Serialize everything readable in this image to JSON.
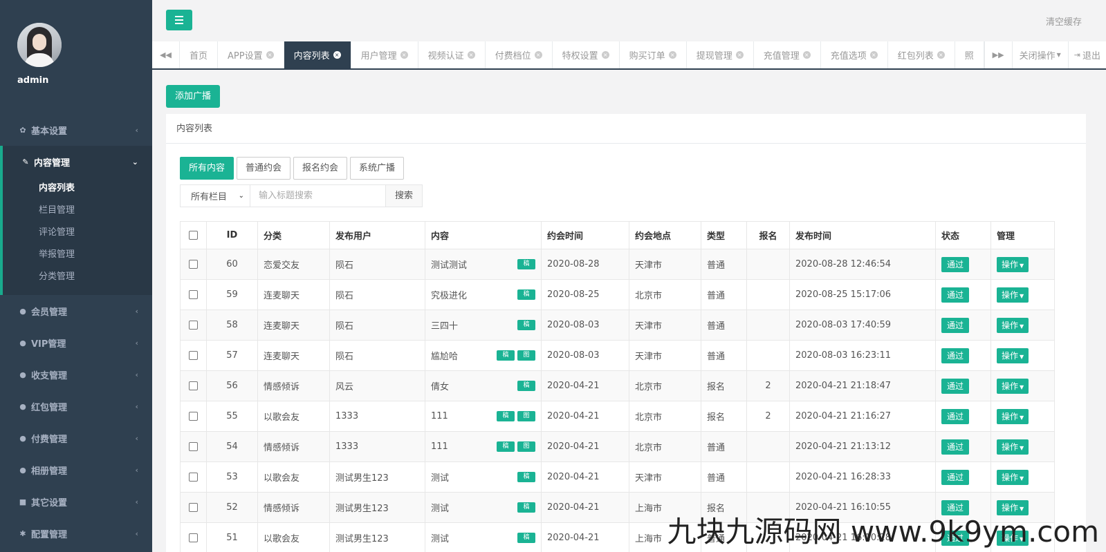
{
  "sidebar": {
    "username": "admin",
    "menu": [
      {
        "label": "基本设置",
        "icon": "gear-icon",
        "glyph": "✿"
      },
      {
        "label": "内容管理",
        "icon": "edit-icon",
        "glyph": "✎",
        "expanded": true,
        "children": [
          "内容列表",
          "栏目管理",
          "评论管理",
          "举报管理",
          "分类管理"
        ]
      },
      {
        "label": "会员管理",
        "icon": "user-icon",
        "glyph": "●"
      },
      {
        "label": "VIP管理",
        "icon": "user-icon",
        "glyph": "●"
      },
      {
        "label": "收支管理",
        "icon": "user-icon",
        "glyph": "●"
      },
      {
        "label": "红包管理",
        "icon": "user-icon",
        "glyph": "●"
      },
      {
        "label": "付费管理",
        "icon": "user-icon",
        "glyph": "●"
      },
      {
        "label": "相册管理",
        "icon": "user-icon",
        "glyph": "●"
      },
      {
        "label": "其它设置",
        "icon": "list-icon",
        "glyph": "■"
      },
      {
        "label": "配置管理",
        "icon": "asterisk-icon",
        "glyph": "✱"
      }
    ]
  },
  "topbar": {
    "clear_cache": "清空缓存"
  },
  "tabs": {
    "items": [
      {
        "label": "首页",
        "closable": false
      },
      {
        "label": "APP设置",
        "closable": true
      },
      {
        "label": "内容列表",
        "closable": true,
        "active": true
      },
      {
        "label": "用户管理",
        "closable": true
      },
      {
        "label": "视频认证",
        "closable": true
      },
      {
        "label": "付费档位",
        "closable": true
      },
      {
        "label": "特权设置",
        "closable": true
      },
      {
        "label": "购买订单",
        "closable": true
      },
      {
        "label": "提现管理",
        "closable": true
      },
      {
        "label": "充值管理",
        "closable": true
      },
      {
        "label": "充值选项",
        "closable": true
      },
      {
        "label": "红包列表",
        "closable": true
      },
      {
        "label": "照",
        "closable": false
      }
    ],
    "close_ops": "关闭操作",
    "logout": "退出"
  },
  "main": {
    "add_button": "添加广播",
    "panel_title": "内容列表",
    "filters": [
      "所有内容",
      "普通约会",
      "报名约会",
      "系统广播"
    ],
    "category_select": "所有栏目",
    "search_placeholder": "输入标题搜索",
    "search_button": "搜索",
    "table": {
      "columns": [
        "ID",
        "分类",
        "发布用户",
        "内容",
        "约会时间",
        "约会地点",
        "类型",
        "报名",
        "发布时间",
        "状态",
        "管理"
      ],
      "tag_labels": {
        "draft": "稿",
        "image": "图"
      },
      "status_label": "通过",
      "op_label": "操作",
      "rows": [
        {
          "id": "60",
          "category": "恋爱交友",
          "user": "陨石",
          "content": "测试测试",
          "tags": [
            "稿"
          ],
          "date": "2020-08-28",
          "place": "天津市",
          "type": "普通",
          "signup": "",
          "published": "2020-08-28 12:46:54"
        },
        {
          "id": "59",
          "category": "连麦聊天",
          "user": "陨石",
          "content": "究极进化",
          "tags": [
            "稿"
          ],
          "date": "2020-08-25",
          "place": "北京市",
          "type": "普通",
          "signup": "",
          "published": "2020-08-25 15:17:06"
        },
        {
          "id": "58",
          "category": "连麦聊天",
          "user": "陨石",
          "content": "三四十",
          "tags": [
            "稿"
          ],
          "date": "2020-08-03",
          "place": "天津市",
          "type": "普通",
          "signup": "",
          "published": "2020-08-03 17:40:59"
        },
        {
          "id": "57",
          "category": "连麦聊天",
          "user": "陨石",
          "content": "尴尬哈",
          "tags": [
            "稿",
            "图"
          ],
          "date": "2020-08-03",
          "place": "天津市",
          "type": "普通",
          "signup": "",
          "published": "2020-08-03 16:23:11"
        },
        {
          "id": "56",
          "category": "情感倾诉",
          "user": "风云",
          "content": "倩女",
          "tags": [
            "稿"
          ],
          "date": "2020-04-21",
          "place": "北京市",
          "type": "报名",
          "signup": "2",
          "published": "2020-04-21 21:18:47"
        },
        {
          "id": "55",
          "category": "以歌会友",
          "user": "1333",
          "content": "111",
          "tags": [
            "稿",
            "图"
          ],
          "date": "2020-04-21",
          "place": "北京市",
          "type": "报名",
          "signup": "2",
          "published": "2020-04-21 21:16:27"
        },
        {
          "id": "54",
          "category": "情感倾诉",
          "user": "1333",
          "content": "111",
          "tags": [
            "稿",
            "图"
          ],
          "date": "2020-04-21",
          "place": "北京市",
          "type": "普通",
          "signup": "",
          "published": "2020-04-21 21:13:12"
        },
        {
          "id": "53",
          "category": "以歌会友",
          "user": "测试男生123",
          "content": "测试",
          "tags": [
            "稿"
          ],
          "date": "2020-04-21",
          "place": "天津市",
          "type": "普通",
          "signup": "",
          "published": "2020-04-21 16:28:33"
        },
        {
          "id": "52",
          "category": "情感倾诉",
          "user": "测试男生123",
          "content": "测试",
          "tags": [
            "稿"
          ],
          "date": "2020-04-21",
          "place": "上海市",
          "type": "报名",
          "signup": "",
          "published": "2020-04-21 16:10:55"
        },
        {
          "id": "51",
          "category": "以歌会友",
          "user": "测试男生123",
          "content": "测试",
          "tags": [
            "稿"
          ],
          "date": "2020-04-21",
          "place": "上海市",
          "type": "普通",
          "signup": "",
          "published": "2020-04-21 16:10:28"
        }
      ]
    }
  },
  "watermark": "九块九源码网 www.9k9ym.com",
  "colors": {
    "accent": "#1ab394",
    "sidebar": "#2f4050",
    "sidebar_active": "#293846"
  }
}
